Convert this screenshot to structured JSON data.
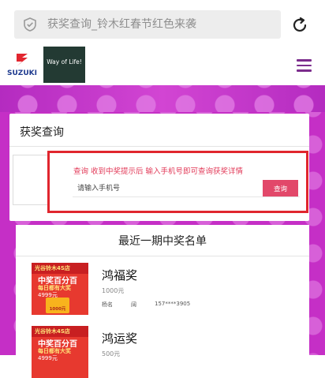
{
  "browser": {
    "url_text": "获奖查询_铃木红春节红色来袭"
  },
  "header": {
    "brand": "SUZUKI",
    "tagline": "Way of Life!"
  },
  "query": {
    "title": "获奖查询",
    "hint": "查询 收到中奖提示后 输入手机号即可查询获奖详情",
    "placeholder": "请输入手机号",
    "button_label": "查询"
  },
  "winners": {
    "title": "最近一期中奖名单",
    "items": [
      {
        "prize": "鸿福奖",
        "amount": "1000元",
        "name": "杨名",
        "extra": "阔",
        "phone": "157****3905",
        "thumb": {
          "line1": "光谷铃木4S店",
          "line2": "中奖百分百",
          "line3": "每日都有大奖",
          "line4": "4999元",
          "value": "1000元"
        }
      },
      {
        "prize": "鸿运奖",
        "amount": "500元",
        "thumb": {
          "line1": "光谷铃木4S店",
          "line2": "中奖百分百",
          "line3": "每日都有大奖",
          "line4": "4999元"
        }
      }
    ]
  },
  "colors": {
    "brand_purple": "#c52fc6",
    "highlight_red": "#e0262e",
    "button_pink": "#e2486a"
  },
  "icons": [
    "shield-icon",
    "reload-icon",
    "suzuki-logo-icon",
    "menu-icon"
  ]
}
